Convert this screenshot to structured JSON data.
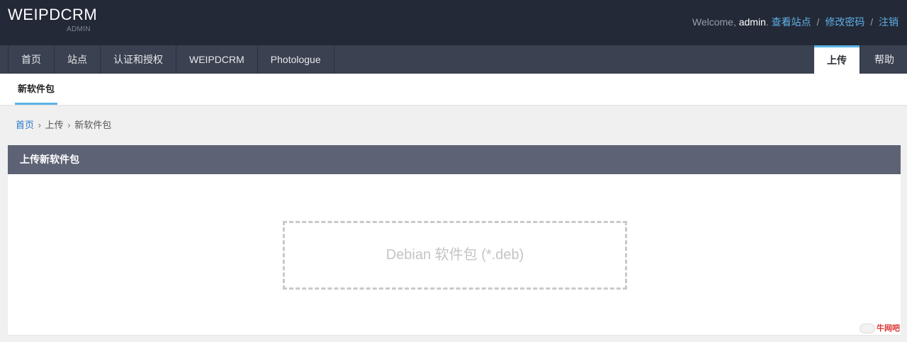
{
  "brand": {
    "title": "WEIPDCRM",
    "subtitle": "ADMIN"
  },
  "user_tools": {
    "welcome": "Welcome, ",
    "username": "admin",
    "view_site": "查看站点",
    "change_password": "修改密码",
    "logout": "注销",
    "separator": "/"
  },
  "nav": {
    "items": [
      {
        "label": "首页"
      },
      {
        "label": "站点"
      },
      {
        "label": "认证和授权"
      },
      {
        "label": "WEIPDCRM"
      },
      {
        "label": "Photologue"
      }
    ],
    "right": [
      {
        "label": "上传"
      },
      {
        "label": "帮助"
      }
    ]
  },
  "subnav": {
    "active_tab": "新软件包"
  },
  "breadcrumb": {
    "home": "首页",
    "upload": "上传",
    "current": "新软件包",
    "sep": "›"
  },
  "panel": {
    "title": "上传新软件包",
    "dropzone_text": "Debian 软件包 (*.deb)"
  },
  "watermark": {
    "text": "牛网吧"
  },
  "colors": {
    "header_bg": "#232936",
    "navbar_bg": "#3a4150",
    "accent": "#5ab2e6",
    "link": "#2a78c5",
    "panel_header_bg": "#5d6375"
  }
}
